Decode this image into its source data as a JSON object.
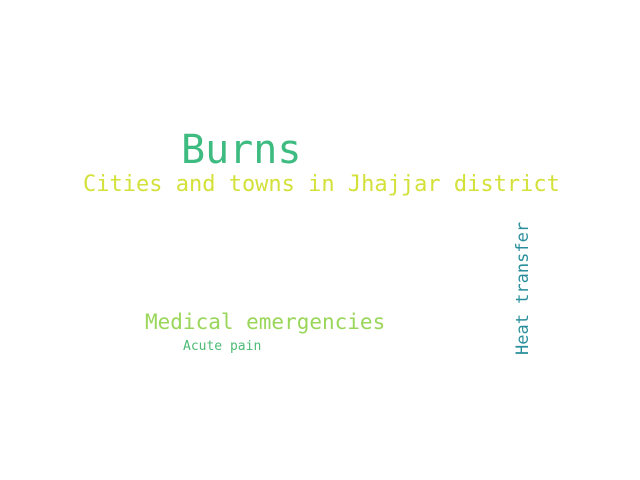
{
  "words": [
    {
      "text": "Burns",
      "color": "#3dbb80"
    },
    {
      "text": "Cities and towns in Jhajjar district",
      "color": "#d3e13a"
    },
    {
      "text": "Medical emergencies",
      "color": "#9ad65a"
    },
    {
      "text": "Acute pain",
      "color": "#4cbc75"
    },
    {
      "text": "Heat transfer",
      "color": "#2a8f9b"
    }
  ],
  "background_color": "#ffffff"
}
